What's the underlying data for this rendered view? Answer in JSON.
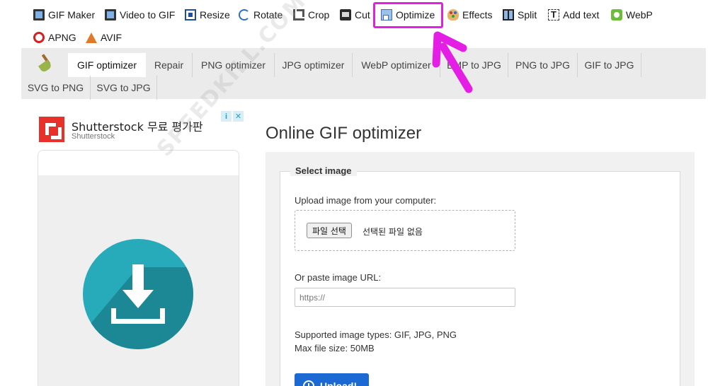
{
  "top_nav": {
    "items": [
      {
        "label": "GIF Maker",
        "icon": "gif-maker-icon"
      },
      {
        "label": "Video to GIF",
        "icon": "film-icon"
      },
      {
        "label": "Resize",
        "icon": "resize-icon"
      },
      {
        "label": "Rotate",
        "icon": "rotate-icon"
      },
      {
        "label": "Crop",
        "icon": "crop-icon"
      },
      {
        "label": "Cut",
        "icon": "cut-icon"
      },
      {
        "label": "Optimize",
        "icon": "optimize-icon"
      },
      {
        "label": "Effects",
        "icon": "palette-icon"
      },
      {
        "label": "Split",
        "icon": "split-icon"
      },
      {
        "label": "Add text",
        "icon": "text-icon"
      },
      {
        "label": "WebP",
        "icon": "webp-icon"
      },
      {
        "label": "APNG",
        "icon": "apng-icon"
      },
      {
        "label": "AVIF",
        "icon": "avif-icon"
      }
    ],
    "highlight_color": "#e51ee5"
  },
  "sub_tabs": {
    "items": [
      {
        "label": "GIF optimizer",
        "active": true
      },
      {
        "label": "Repair"
      },
      {
        "label": "PNG optimizer"
      },
      {
        "label": "JPG optimizer"
      },
      {
        "label": "WebP optimizer"
      },
      {
        "label": "BMP to JPG"
      },
      {
        "label": "PNG to JPG"
      },
      {
        "label": "GIF to JPG"
      },
      {
        "label": "SVG to PNG"
      },
      {
        "label": "SVG to JPG"
      }
    ]
  },
  "ad": {
    "title": "Shutterstock 무료 평가판",
    "subtitle": "Shutterstock",
    "info_glyph": "i",
    "close_glyph": "✕"
  },
  "main": {
    "title": "Online GIF optimizer",
    "legend": "Select image",
    "upload_label": "Upload image from your computer:",
    "file_button": "파일 선택",
    "file_status": "선택된 파일 없음",
    "url_label": "Or paste image URL:",
    "url_placeholder": "https://",
    "supported_types": "Supported image types: GIF, JPG, PNG",
    "max_size": "Max file size: 50MB",
    "upload_button": "Upload!"
  },
  "watermark": "SPEEDKILL.COM",
  "colors": {
    "accent": "#1c69d3",
    "annotation": "#e51ee5"
  }
}
